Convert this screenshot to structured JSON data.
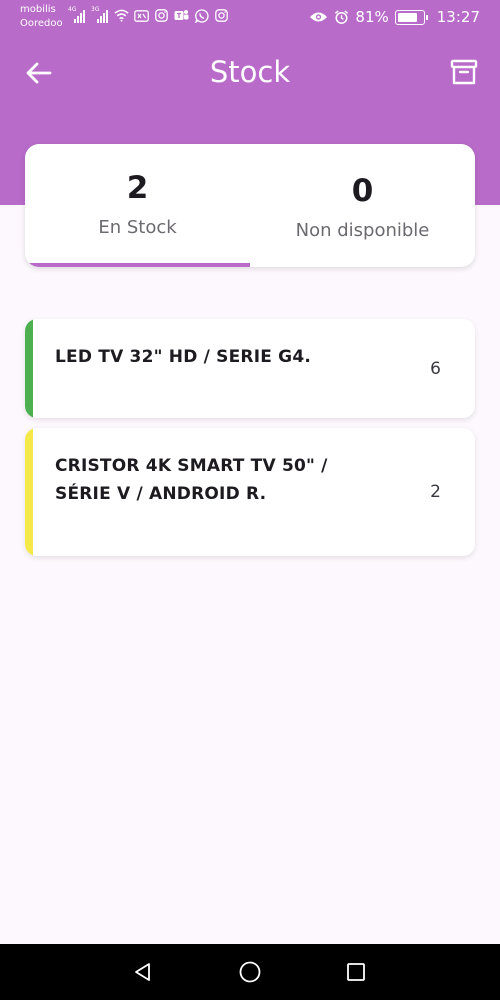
{
  "status_bar": {
    "carrier_1": "mobilis",
    "carrier_2": "Ooredoo",
    "network_1": "4G",
    "network_2": "3G",
    "battery": "81%",
    "battery_level": 0.81,
    "time": "13:27",
    "icons": [
      "signal-icon",
      "signal-icon",
      "wifi-icon",
      "vpn-icon",
      "instagram-icon",
      "teams-icon",
      "whatsapp-icon",
      "instagram-icon",
      "eye-icon",
      "alarm-icon",
      "battery-icon"
    ]
  },
  "app_bar": {
    "title": "Stock",
    "back_icon": "arrow-left-icon",
    "action_icon": "archive-icon"
  },
  "summary": {
    "in_stock": {
      "count": "2",
      "label": "En Stock"
    },
    "unavailable": {
      "count": "0",
      "label": "Non disponible"
    },
    "selected_tab": "in_stock"
  },
  "products": [
    {
      "name": "LED TV 32\" HD / SERIE G4.",
      "quantity": "6",
      "accent_color": "#4caf50"
    },
    {
      "name": "CRISTOR 4K SMART TV 50\" / SÉRIE V / ANDROID R.",
      "quantity": "2",
      "accent_color": "#f5e94a"
    }
  ],
  "colors": {
    "primary": "#b86bc9",
    "background": "#fdf8fd"
  },
  "nav_bar": {
    "icons": [
      "back-triangle-icon",
      "home-circle-icon",
      "recents-square-icon"
    ]
  }
}
